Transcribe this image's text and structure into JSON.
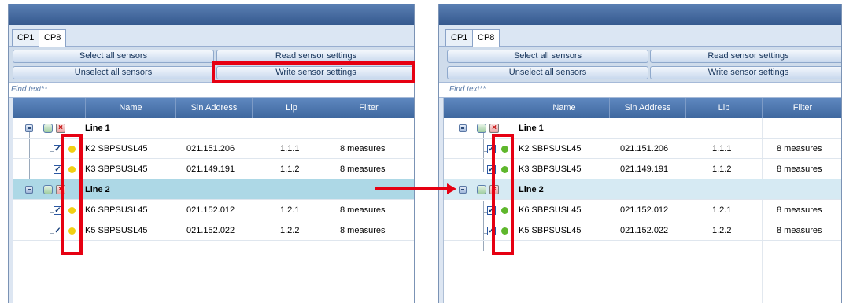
{
  "colors": {
    "led_before": "#f0cf14",
    "led_after": "#5fb72c",
    "highlight": "#e60012",
    "selected_row": "#add8e6"
  },
  "panels": [
    {
      "id": "before",
      "tabs": [
        "CP1",
        "CP8"
      ],
      "buttons": {
        "select_all": "Select all sensors",
        "read": "Read sensor settings",
        "unselect_all": "Unselect all sensors",
        "write": "Write sensor settings"
      },
      "search_placeholder": "Find text**",
      "columns": [
        "Name",
        "Sin Address",
        "Llp",
        "Filter"
      ],
      "groups": [
        {
          "label": "Line 1",
          "rows": [
            {
              "name": "K2 SBPSUSL45",
              "sin": "021.151.206",
              "llp": "1.1.1",
              "filter": "8 measures",
              "led_icon": "yellow-led"
            },
            {
              "name": "K3 SBPSUSL45",
              "sin": "021.149.191",
              "llp": "1.1.2",
              "filter": "8 measures",
              "led_icon": "yellow-led"
            }
          ]
        },
        {
          "label": "Line 2",
          "rows": [
            {
              "name": "K6 SBPSUSL45",
              "sin": "021.152.012",
              "llp": "1.2.1",
              "filter": "8 measures",
              "led_icon": "yellow-led"
            },
            {
              "name": "K5 SBPSUSL45",
              "sin": "021.152.022",
              "llp": "1.2.2",
              "filter": "8 measures",
              "led_icon": "yellow-led"
            }
          ]
        }
      ]
    },
    {
      "id": "after",
      "tabs": [
        "CP1",
        "CP8"
      ],
      "buttons": {
        "select_all": "Select all sensors",
        "read": "Read sensor settings",
        "unselect_all": "Unselect all sensors",
        "write": "Write sensor settings"
      },
      "search_placeholder": "Find text**",
      "columns": [
        "Name",
        "Sin Address",
        "Llp",
        "Filter"
      ],
      "groups": [
        {
          "label": "Line 1",
          "rows": [
            {
              "name": "K2 SBPSUSL45",
              "sin": "021.151.206",
              "llp": "1.1.1",
              "filter": "8 measures",
              "led_icon": "green-led"
            },
            {
              "name": "K3 SBPSUSL45",
              "sin": "021.149.191",
              "llp": "1.1.2",
              "filter": "8 measures",
              "led_icon": "green-led"
            }
          ]
        },
        {
          "label": "Line 2",
          "rows": [
            {
              "name": "K6 SBPSUSL45",
              "sin": "021.152.012",
              "llp": "1.2.1",
              "filter": "8 measures",
              "led_icon": "green-led"
            },
            {
              "name": "K5 SBPSUSL45",
              "sin": "021.152.022",
              "llp": "1.2.2",
              "filter": "8 measures",
              "led_icon": "green-led"
            }
          ]
        }
      ]
    }
  ]
}
